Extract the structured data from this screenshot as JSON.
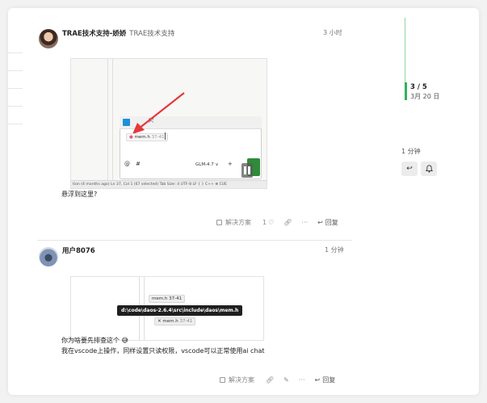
{
  "posts": [
    {
      "username": "TRAE技术支持-娇娇",
      "user_title": "TRAE技术支持",
      "time": "3 小时",
      "text": "悬浮到这里?",
      "screenshot": {
        "tag_label": "mem.h",
        "tag_range": "37-41",
        "model": "GLM-4.7 ∨",
        "at": "@",
        "hash": "#",
        "status_text": "tion (4 months ago)    Ln 37, Col 1 (67 selected)   Tab Size: 4   UTF-8   LF   { }   C++   ⊕ CUE"
      },
      "actions": {
        "solution": "解决方案",
        "likes": "1",
        "more": "···",
        "reply": "回复"
      }
    },
    {
      "username": "用户8076",
      "time": "1 分钟",
      "text_line1": "你为啥要先排查这个 😅",
      "text_line2": "我在vscode上操作，同样设置只读权限，vscode可以正常使用ai chat",
      "screenshot": {
        "tooltip": "d:\\code\\daos-2.6.4\\src\\include\\daos\\mem.h",
        "chip_top": "mem.h 37-41",
        "chip_bottom": "mem.h",
        "chip_bottom_range": "37-41"
      },
      "actions": {
        "solution": "解决方案",
        "more": "···",
        "reply": "回复"
      }
    }
  ],
  "timeline": {
    "count": "3 / 5",
    "date": "3月 20 日",
    "later": "1 分钟"
  },
  "colors": {
    "accent_green": "#2fb35b",
    "arrow_red": "#e5383b"
  }
}
